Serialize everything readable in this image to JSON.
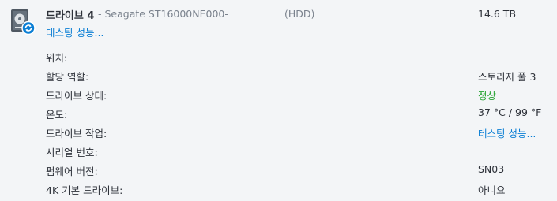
{
  "drive": {
    "name": "드라이브 4",
    "model": "- Seagate ST16000NE000-",
    "type": "(HDD)",
    "size": "14.6 TB",
    "status_text": "테스팅 성능..."
  },
  "details": {
    "location_label": "위치:",
    "location_value": "",
    "role_label": "할당 역할:",
    "role_value": "스토리지 풀 3",
    "health_label": "드라이브 상태:",
    "health_value": "정상",
    "temp_label": "온도:",
    "temp_value": "37 °C / 99 °F",
    "task_label": "드라이브 작업:",
    "task_value": "테스팅 성능...",
    "serial_label": "시리얼 번호:",
    "serial_value": "",
    "firmware_label": "펌웨어 버전:",
    "firmware_value": "SN03",
    "native4k_label": "4K 기본 드라이브:",
    "native4k_value": "아니요"
  },
  "colors": {
    "accent": "#0a7ed4",
    "healthy": "#27a433",
    "muted": "#7a828d",
    "text": "#2d3139",
    "background": "#f3f5f7"
  },
  "icons": {
    "drive": "hard-drive-icon",
    "badge": "sync-badge-icon"
  }
}
